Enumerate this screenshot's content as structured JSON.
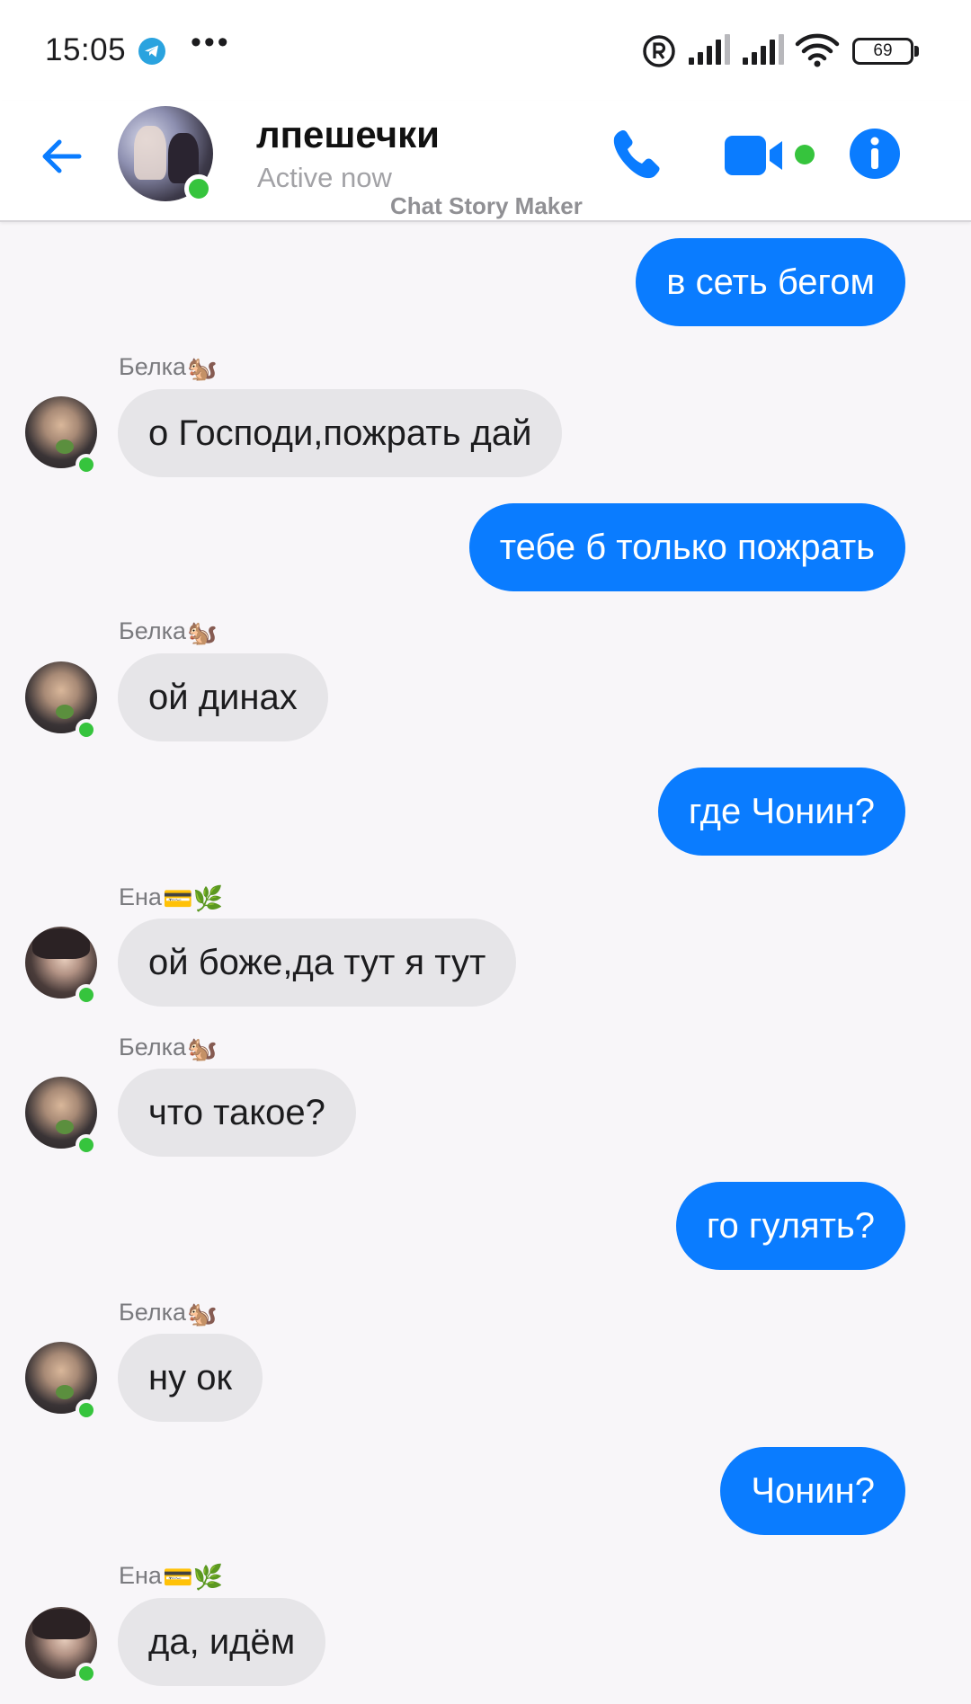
{
  "status_bar": {
    "time": "15:05",
    "app_notification_icon": "telegram-icon",
    "more_indicator": "•••",
    "battery_level": "69",
    "icons": [
      "registered-icon",
      "signal-icon",
      "signal-icon",
      "wifi-icon",
      "battery-icon"
    ]
  },
  "header": {
    "back_icon": "arrow-left-icon",
    "title": "лпешечки",
    "status": "Active now",
    "watermark": "Chat Story Maker",
    "actions": [
      "phone-icon",
      "video-camera-icon",
      "info-icon"
    ]
  },
  "colors": {
    "accent": "#0a7cff",
    "incoming_bubble": "#e6e5e8",
    "online": "#36c43d",
    "background": "#f8f6f9"
  },
  "messages": [
    {
      "direction": "out",
      "text": "в сеть бегом"
    },
    {
      "direction": "in",
      "sender": "Белка",
      "sender_emoji": "🐿️",
      "text": "о Господи,пожрать дай"
    },
    {
      "direction": "out",
      "text": "тебе б только пожрать"
    },
    {
      "direction": "in",
      "sender": "Белка",
      "sender_emoji": "🐿️",
      "text": "ой динах"
    },
    {
      "direction": "out",
      "text": "где Чонин?"
    },
    {
      "direction": "in",
      "sender": "Ена",
      "sender_emoji": "💳🌿",
      "text": "ой боже,да тут я тут"
    },
    {
      "direction": "in",
      "sender": "Белка",
      "sender_emoji": "🐿️",
      "text": "что такое?"
    },
    {
      "direction": "out",
      "text": "го гулять?"
    },
    {
      "direction": "in",
      "sender": "Белка",
      "sender_emoji": "🐿️",
      "text": "ну ок"
    },
    {
      "direction": "out",
      "text": "Чонин?"
    },
    {
      "direction": "in",
      "sender": "Ена",
      "sender_emoji": "💳🌿",
      "text": "да, идём"
    }
  ]
}
